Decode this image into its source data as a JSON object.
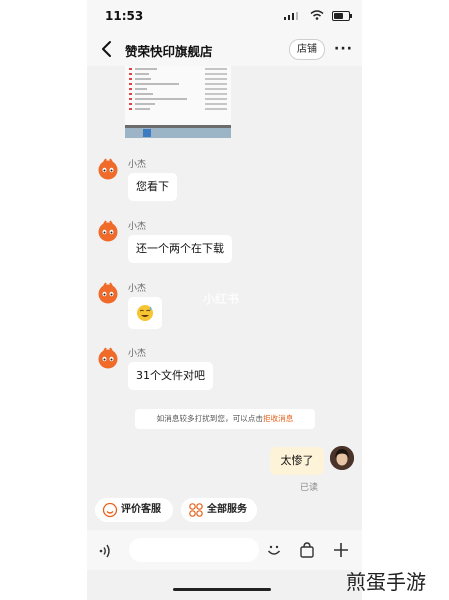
{
  "status_bar": {
    "time": "11:53"
  },
  "header": {
    "title": "赞荣快印旗舰店",
    "store_button": "店铺",
    "more_label": "···"
  },
  "messages": [
    {
      "sender": "小杰",
      "text": "您看下"
    },
    {
      "sender": "小杰",
      "text": "还一个两个在下载"
    },
    {
      "sender": "小杰",
      "emoji": "sweat-smile-emoji"
    },
    {
      "sender": "小杰",
      "text": "31个文件对吧"
    }
  ],
  "watermark": "小红书",
  "notice": {
    "text": "如消息较多打扰到您，可以点击",
    "link": "拒收消息"
  },
  "my_message": {
    "text": "太惨了",
    "read_status": "已读"
  },
  "quick_actions": [
    {
      "label": "评价客服",
      "icon": "smile-icon"
    },
    {
      "label": "全部服务",
      "icon": "grid-icon"
    }
  ],
  "input_bar": {
    "placeholder": ""
  },
  "brand_watermark": "煎蛋手游",
  "colors": {
    "accent": "#e8621c",
    "my_bubble": "#fdf3d9",
    "background": "#f1f1f1"
  }
}
